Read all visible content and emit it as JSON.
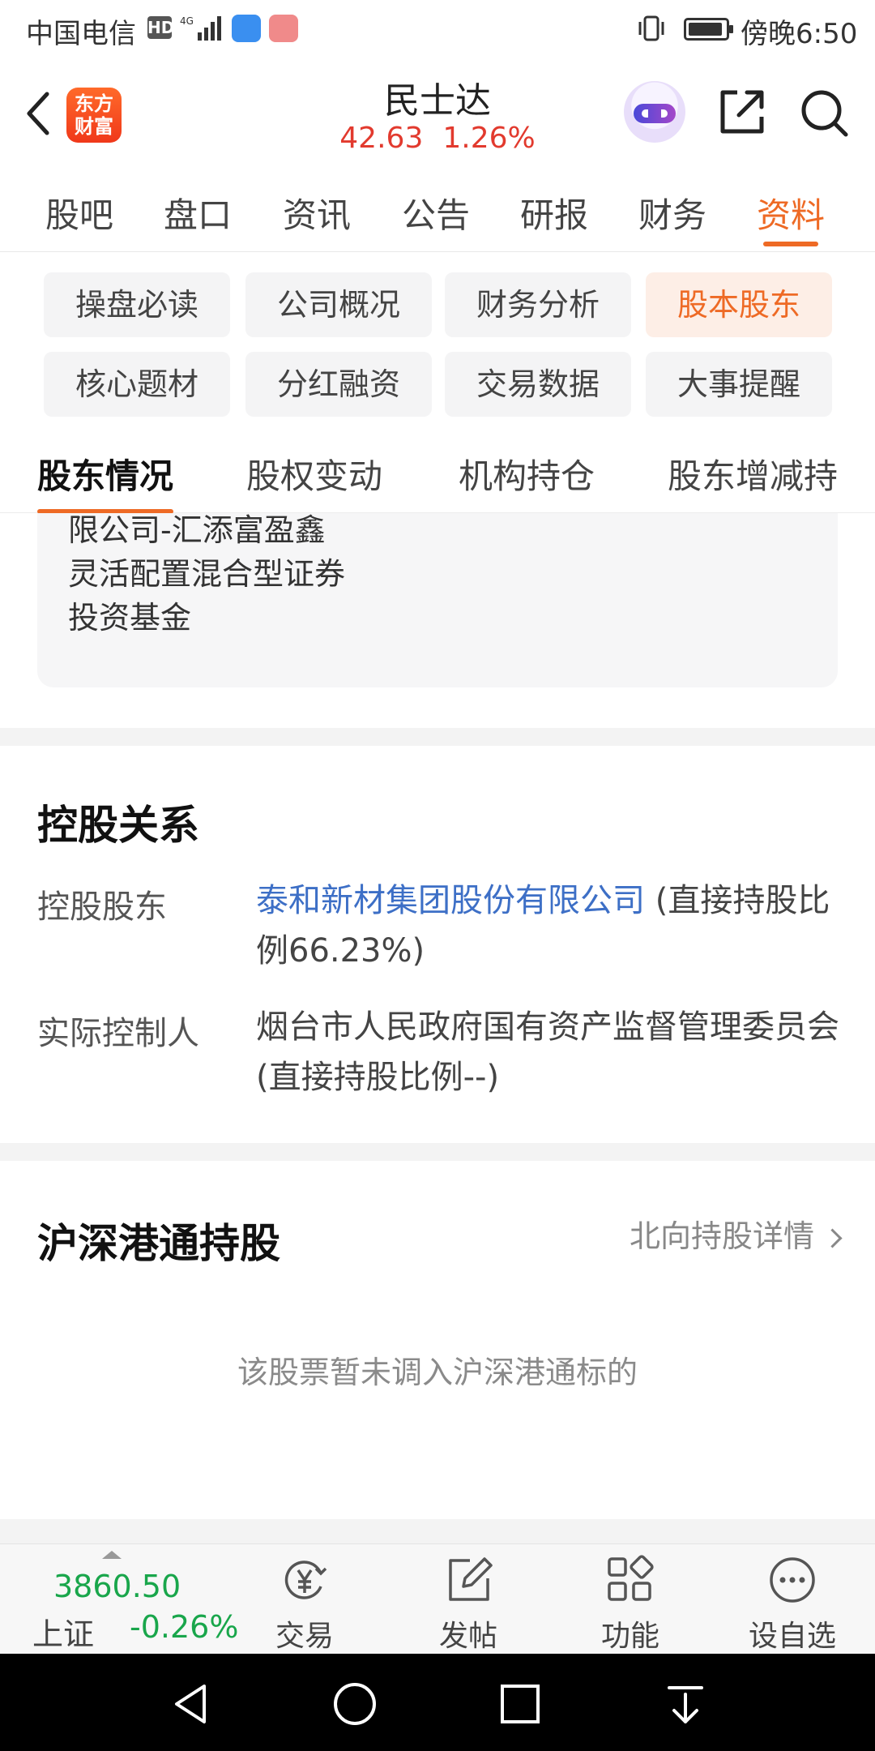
{
  "status_bar": {
    "carrier": "中国电信",
    "hd": "HD",
    "time": "傍晚6:50"
  },
  "header": {
    "logo_line1": "东方",
    "logo_line2": "财富",
    "stock_name": "民士达",
    "price": "42.63",
    "change_pct": "1.26%"
  },
  "main_tabs": [
    {
      "label": "股吧"
    },
    {
      "label": "盘口"
    },
    {
      "label": "资讯"
    },
    {
      "label": "公告"
    },
    {
      "label": "研报"
    },
    {
      "label": "财务"
    },
    {
      "label": "资料",
      "active": true
    }
  ],
  "categories": [
    {
      "label": "操盘必读"
    },
    {
      "label": "公司概况"
    },
    {
      "label": "财务分析"
    },
    {
      "label": "股本股东",
      "active": true
    },
    {
      "label": "核心题材"
    },
    {
      "label": "分红融资"
    },
    {
      "label": "交易数据"
    },
    {
      "label": "大事提醒"
    }
  ],
  "sub_tabs": [
    {
      "label": "股东情况",
      "active": true
    },
    {
      "label": "股权变动"
    },
    {
      "label": "机构持仓"
    },
    {
      "label": "股东增减持"
    }
  ],
  "fund_card": {
    "lines": [
      "限公司-汇添富盈鑫",
      "灵活配置混合型证券",
      "投资基金"
    ]
  },
  "holding": {
    "title": "控股关系",
    "controlling_label": "控股股东",
    "controlling_name": "泰和新材集团股份有限公司",
    "controlling_ratio": "(直接持股比例66.23%)",
    "actual_label": "实际控制人",
    "actual_name": "烟台市人民政府国有资产监督管理委员会",
    "actual_ratio": "(直接持股比例--)"
  },
  "hk_connect": {
    "title": "沪深港通持股",
    "link_label": "北向持股详情",
    "empty_note": "该股票暂未调入沪深港通标的"
  },
  "bottom_bar": {
    "index_value": "3860.50",
    "index_name": "上证",
    "index_change": "-0.26%",
    "items": [
      {
        "label": "交易"
      },
      {
        "label": "发帖"
      },
      {
        "label": "功能"
      },
      {
        "label": "设自选"
      }
    ]
  },
  "colors": {
    "accent": "#ee6a25",
    "price_up": "#e23a2e",
    "price_down": "#19a64b",
    "link": "#3d6fc6"
  }
}
